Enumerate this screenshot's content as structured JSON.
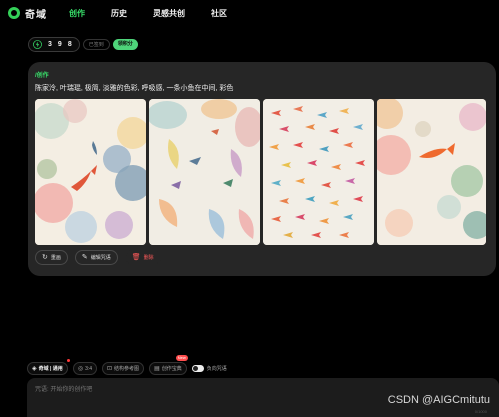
{
  "app": {
    "name": "奇域",
    "logo_icon": "swirl-logo-icon"
  },
  "nav": {
    "items": [
      {
        "label": "创作",
        "active": true
      },
      {
        "label": "历史",
        "active": false
      },
      {
        "label": "灵感共创",
        "active": false
      },
      {
        "label": "社区",
        "active": false
      }
    ]
  },
  "counter": {
    "icon": "lightning-icon",
    "digits": [
      "3",
      "9",
      "8"
    ],
    "btn_left": "已签到",
    "btn_right": "领积分"
  },
  "card": {
    "tag": "/创作",
    "prompt": "陈家泠, 叶瑞琨, 极简, 淡雅的色彩, 呼吸感, 一条小鱼在中间, 彩色",
    "images": [
      "fish-painting-1",
      "fish-painting-2",
      "fish-painting-3",
      "fish-painting-4"
    ],
    "actions": {
      "redraw": "重画",
      "edit_prompt": "编辑咒语",
      "delete": "删除"
    }
  },
  "toolbar": {
    "model": "奇域 | 通用",
    "ratio": "3:4",
    "structure": "结构参考图",
    "treasury": "创作宝典",
    "new_badge": "New",
    "negative": "负向咒语"
  },
  "input": {
    "placeholder": "咒语: 开始你的创作吧",
    "count": "0/1000"
  },
  "watermark": "CSDN @AIGCmitutu",
  "colors": {
    "accent": "#38e06a",
    "danger": "#ff5a5a",
    "card_bg": "#262626"
  }
}
